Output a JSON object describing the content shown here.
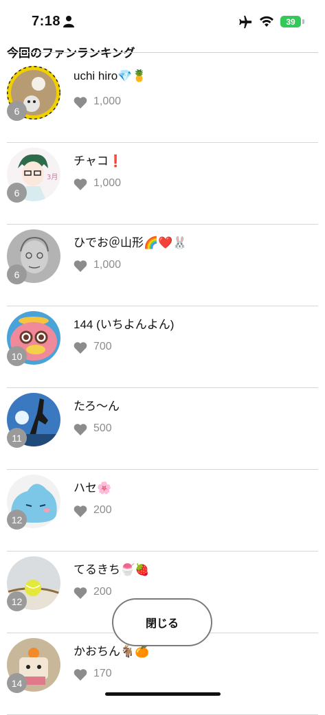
{
  "status_bar": {
    "time": "7:18",
    "battery": "39"
  },
  "title": "今回のファンランキング",
  "icons": {
    "like": "heart-icon",
    "person": "person-icon",
    "airplane": "airplane-icon",
    "wifi": "wifi-icon"
  },
  "rankings": [
    {
      "rank": "6",
      "name": "uchi hiro💎🍍",
      "count": "1,000"
    },
    {
      "rank": "6",
      "name": "チャコ❗",
      "count": "1,000"
    },
    {
      "rank": "6",
      "name": "ひでお＠山形🌈❤️🐰",
      "count": "1,000"
    },
    {
      "rank": "10",
      "name": "144 (いちよんよん)",
      "count": "700"
    },
    {
      "rank": "11",
      "name": "たろ〜ん",
      "count": "500"
    },
    {
      "rank": "12",
      "name": "ハセ🌸",
      "count": "200"
    },
    {
      "rank": "12",
      "name": "てるきち🍧🍓",
      "count": "200"
    },
    {
      "rank": "14",
      "name": "かおちん🐐🍊",
      "count": "170"
    }
  ],
  "close_label": "閉じる",
  "colors": {
    "battery": "#34c759",
    "badge": "#9a9a9a",
    "heart": "#8c8c8c"
  }
}
